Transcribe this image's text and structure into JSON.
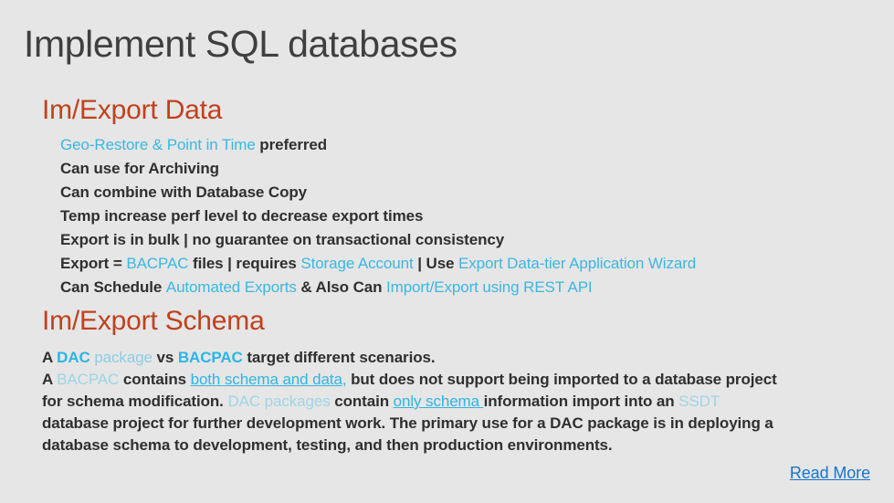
{
  "slide": {
    "title": "Implement SQL databases",
    "background_color": "#e6e6e6",
    "title_color": "#3f3f3f",
    "heading_color": "#c0411e",
    "body_color": "#2f2f2f",
    "accent_cyan": "#29b6e8",
    "accent_cyan_light": "#8dcce1",
    "link_color": "#1874cd"
  },
  "sections": {
    "imexport_data": {
      "heading": "Im/Export Data",
      "bullets": {
        "b1": {
          "p1": "Geo-Restore & Point in Time",
          "p2": "preferred"
        },
        "b2": {
          "p1": "Can use for Archiving"
        },
        "b3": {
          "p1": "Can combine with Database Copy"
        },
        "b4": {
          "p1": "Temp increase perf level to decrease export times"
        },
        "b5": {
          "p1": "Export is in bulk | no guarantee on transactional consistency"
        },
        "b6": {
          "p1": "Export = ",
          "p2": "BACPAC",
          "p3": " files | requires ",
          "p4": "Storage Account",
          "p5": " | Use ",
          "p6": "Export Data-tier Application Wizard"
        },
        "b7": {
          "p1": "Can Schedule ",
          "p2": "Automated Exports",
          "p3": " & Also Can ",
          "p4": "Import/Export using REST API"
        }
      }
    },
    "imexport_schema": {
      "heading": "Im/Export Schema",
      "paragraph": {
        "line1": {
          "p1": "A ",
          "p2": "DAC",
          "p3": " package ",
          "p4": "vs ",
          "p5": "BACPAC",
          "p6": " target different scenarios."
        },
        "line2": {
          "p1": "A ",
          "p2": "BACPAC",
          "p3": " contains ",
          "p4": "both schema and data,",
          "p5": " but does not support being imported to a database project"
        },
        "line3": {
          "p1": "for schema modification. ",
          "p2": "DAC packages",
          "p3": " contain ",
          "p4": "only schema ",
          "p5": "information import  into an ",
          "p6": "SSDT"
        },
        "line4": {
          "p1": "database project for further development work. The primary use for a DAC package is in deploying a"
        },
        "line5": {
          "p1": "database schema to development, testing, and then production environments."
        }
      }
    }
  },
  "footer": {
    "read_more_label": "Read More"
  }
}
